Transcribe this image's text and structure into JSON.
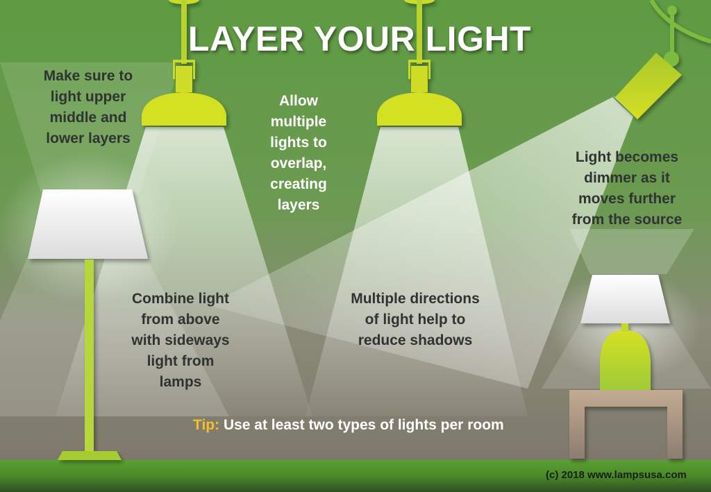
{
  "title": "LAYER YOUR LIGHT",
  "notes": {
    "layers": [
      "Make sure to",
      "light upper",
      "middle and",
      "lower layers"
    ],
    "overlap": [
      "Allow",
      "multiple",
      "lights to",
      "overlap,",
      "creating",
      "layers"
    ],
    "dimmer": [
      "Light becomes",
      "dimmer as it",
      "moves further",
      "from the source"
    ],
    "combine": [
      "Combine light",
      "from above",
      "with sideways",
      "light from",
      "lamps"
    ],
    "directions": [
      "Multiple directions",
      "of light help to",
      "reduce shadows"
    ]
  },
  "tip": {
    "label": "Tip:",
    "text": " Use at least two types of lights per room"
  },
  "copyright": "(c) 2018 www.lampsusa.com",
  "colors": {
    "wall_green": "#5f9a43",
    "lamp_yellow_green": "#d4e02a",
    "lamp_lime": "#a6cc33",
    "floor_green": "#4f8f2a",
    "wall_gray": "#837f70",
    "table_tan": "#bfa88f",
    "tip_accent": "#f2c02a"
  }
}
